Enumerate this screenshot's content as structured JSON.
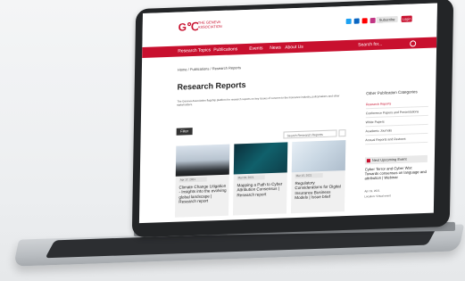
{
  "header": {
    "logo_mark": "G℃",
    "logo_text": "THE GENEVA ASSOCIATION",
    "subscribe": "Subscribe",
    "login": "Login",
    "social_icons": [
      "twitter-icon",
      "linkedin-icon",
      "youtube-icon",
      "instagram-icon",
      "email-icon"
    ]
  },
  "nav": {
    "items": [
      "Research Topics",
      "Publications",
      "Events",
      "News",
      "About Us"
    ],
    "search_label": "Search for..."
  },
  "main": {
    "breadcrumb": "Home / Publications / Research Reports",
    "title": "Research Reports",
    "intro": "The Geneva Association flagship platform for research reports on key issues of concern to the insurance industry, policymakers and other stakeholders.",
    "filter_button": "Filter",
    "search_placeholder": "Search Research Reports"
  },
  "cards": [
    {
      "date": "Apr 17, 2021",
      "title": "Climate Change Litigation - Insights into the evolving global landscape | Research report"
    },
    {
      "date": "Mar 09, 2021",
      "title": "Mapping a Path to Cyber Attribution Consensus | Research report"
    },
    {
      "date": "Mar 15, 2021",
      "title": "Regulatory Considerations for Digital Insurance Business Models | Issue brief"
    }
  ],
  "sidebar": {
    "heading": "Other Publication Categories",
    "items": [
      "Research Reports",
      "Conference Papers and Presentations",
      "White Papers",
      "Academic Journals",
      "Annual Reports and Reviews"
    ]
  },
  "event": {
    "heading": "Next Upcoming Event",
    "title": "Cyber Terror and Cyber War: Towards consensus on language and attribution | Webinar",
    "date": "Apr 19, 2021",
    "location": "Location: Virtual event"
  }
}
